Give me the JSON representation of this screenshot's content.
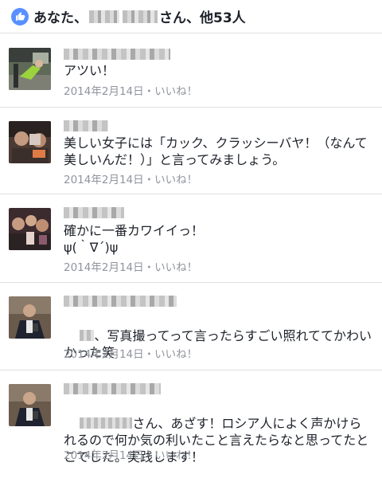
{
  "likes": {
    "prefix": "あなた、",
    "suffix": "さん、他53人",
    "icon": "thumbs-up-icon",
    "icon_color": "#5890ff"
  },
  "comments": [
    {
      "text": "アツい！",
      "date": "2014年2月14日",
      "separator": "・",
      "like_label": "いいね！"
    },
    {
      "text": "美しい女子には「カック、クラッシーバヤ！（なんて美しいんだ！）」と言ってみましょう。",
      "date": "2014年2月14日",
      "separator": "・",
      "like_label": "いいね！"
    },
    {
      "text": "確かに一番カワイイっ！\nψ(｀∇´)ψ",
      "date": "2014年2月14日",
      "separator": "・",
      "like_label": "いいね！"
    },
    {
      "text": "、写真撮ってって言ったらすごい照れててかわいかった笑",
      "date": "2014年2月14日",
      "separator": "・",
      "like_label": "いいね！"
    },
    {
      "text": "さん、あざす！ロシア人によく声かけられるので何か気の利いたこと言えたらなと思ってたとこでした。実践します！",
      "date": "2014年2月14日",
      "separator": "・",
      "like_label": "いいね！"
    }
  ],
  "colors": {
    "text": "#1d2129",
    "meta": "#90949c",
    "divider": "#dddfe2"
  }
}
